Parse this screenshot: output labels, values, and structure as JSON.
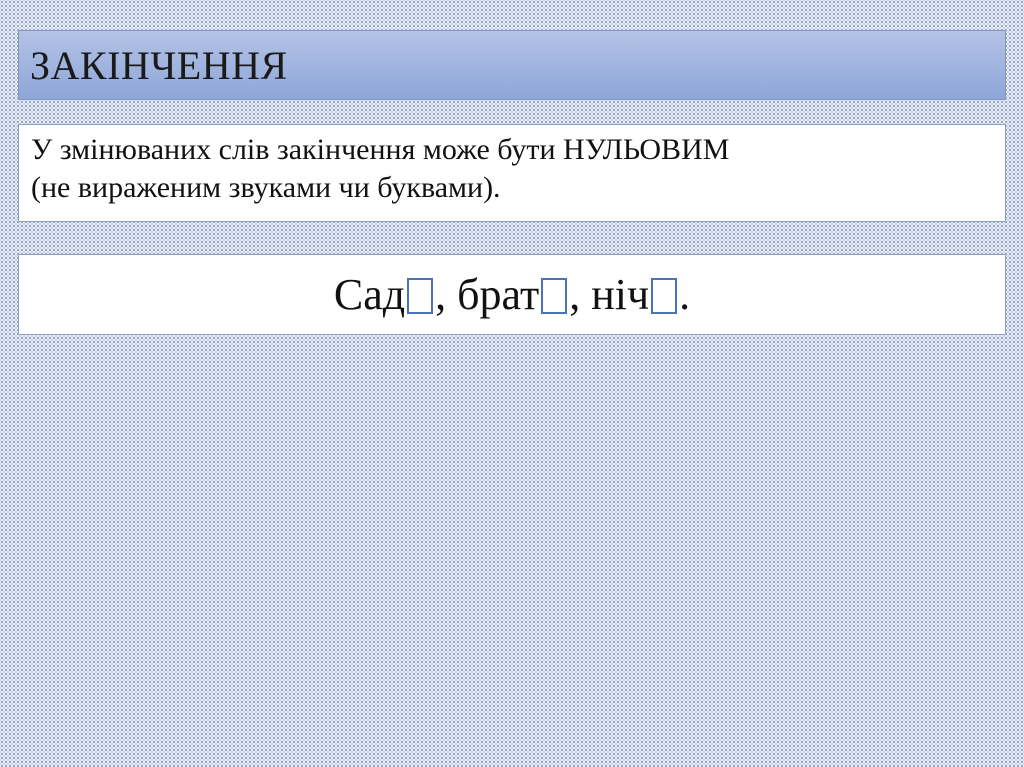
{
  "title": "ЗАКІНЧЕННЯ",
  "definition": {
    "line1": "У змінюваних слів закінчення може бути НУЛЬОВИМ",
    "line2": "(не вираженим звуками чи буквами)."
  },
  "example": {
    "word1": "Сад",
    "sep1": ", брат",
    "sep2": ", ніч",
    "end": "."
  },
  "colors": {
    "title_bar": "#9fb3df",
    "zero_ending_box": "#4a72b8"
  }
}
